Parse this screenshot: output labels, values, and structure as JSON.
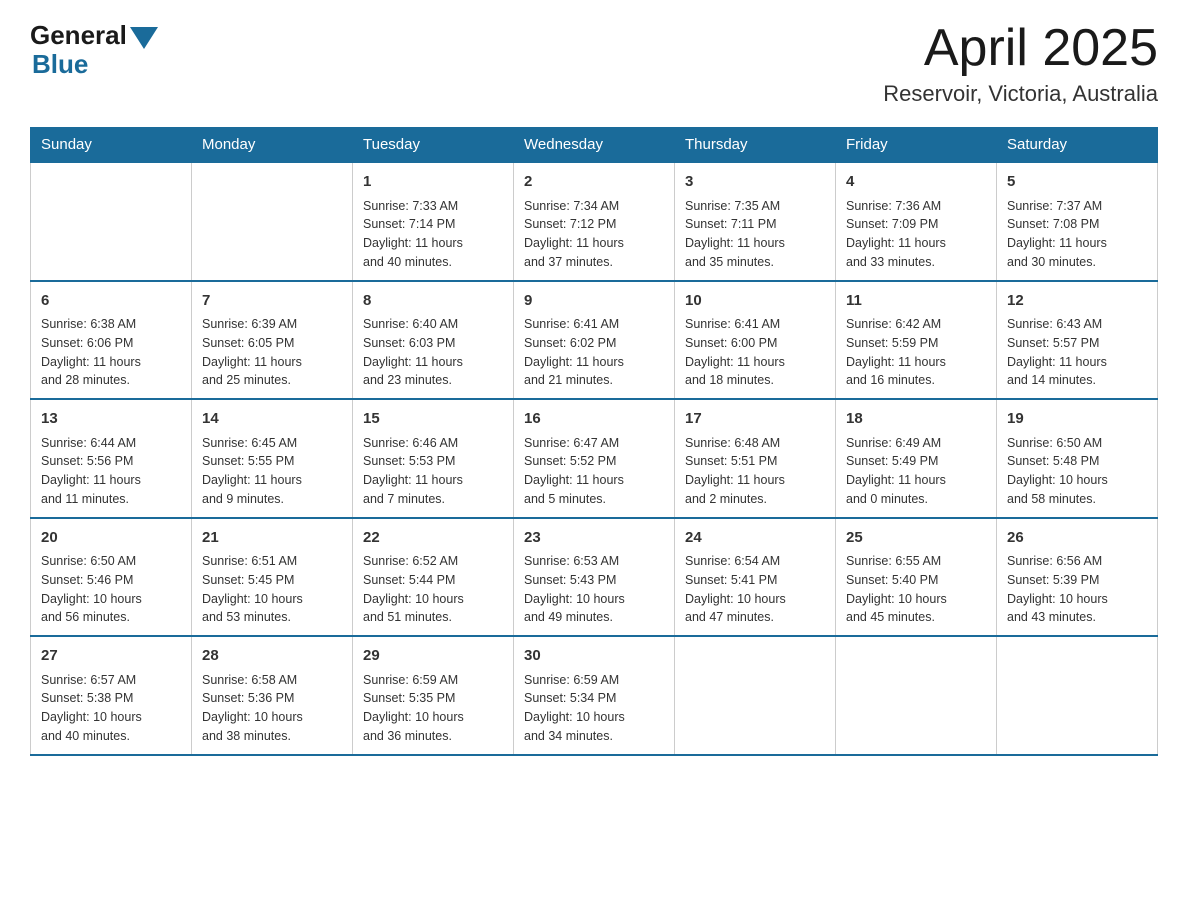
{
  "logo": {
    "general": "General",
    "blue": "Blue"
  },
  "title": "April 2025",
  "subtitle": "Reservoir, Victoria, Australia",
  "days_of_week": [
    "Sunday",
    "Monday",
    "Tuesday",
    "Wednesday",
    "Thursday",
    "Friday",
    "Saturday"
  ],
  "weeks": [
    [
      {
        "day": "",
        "info": ""
      },
      {
        "day": "",
        "info": ""
      },
      {
        "day": "1",
        "info": "Sunrise: 7:33 AM\nSunset: 7:14 PM\nDaylight: 11 hours\nand 40 minutes."
      },
      {
        "day": "2",
        "info": "Sunrise: 7:34 AM\nSunset: 7:12 PM\nDaylight: 11 hours\nand 37 minutes."
      },
      {
        "day": "3",
        "info": "Sunrise: 7:35 AM\nSunset: 7:11 PM\nDaylight: 11 hours\nand 35 minutes."
      },
      {
        "day": "4",
        "info": "Sunrise: 7:36 AM\nSunset: 7:09 PM\nDaylight: 11 hours\nand 33 minutes."
      },
      {
        "day": "5",
        "info": "Sunrise: 7:37 AM\nSunset: 7:08 PM\nDaylight: 11 hours\nand 30 minutes."
      }
    ],
    [
      {
        "day": "6",
        "info": "Sunrise: 6:38 AM\nSunset: 6:06 PM\nDaylight: 11 hours\nand 28 minutes."
      },
      {
        "day": "7",
        "info": "Sunrise: 6:39 AM\nSunset: 6:05 PM\nDaylight: 11 hours\nand 25 minutes."
      },
      {
        "day": "8",
        "info": "Sunrise: 6:40 AM\nSunset: 6:03 PM\nDaylight: 11 hours\nand 23 minutes."
      },
      {
        "day": "9",
        "info": "Sunrise: 6:41 AM\nSunset: 6:02 PM\nDaylight: 11 hours\nand 21 minutes."
      },
      {
        "day": "10",
        "info": "Sunrise: 6:41 AM\nSunset: 6:00 PM\nDaylight: 11 hours\nand 18 minutes."
      },
      {
        "day": "11",
        "info": "Sunrise: 6:42 AM\nSunset: 5:59 PM\nDaylight: 11 hours\nand 16 minutes."
      },
      {
        "day": "12",
        "info": "Sunrise: 6:43 AM\nSunset: 5:57 PM\nDaylight: 11 hours\nand 14 minutes."
      }
    ],
    [
      {
        "day": "13",
        "info": "Sunrise: 6:44 AM\nSunset: 5:56 PM\nDaylight: 11 hours\nand 11 minutes."
      },
      {
        "day": "14",
        "info": "Sunrise: 6:45 AM\nSunset: 5:55 PM\nDaylight: 11 hours\nand 9 minutes."
      },
      {
        "day": "15",
        "info": "Sunrise: 6:46 AM\nSunset: 5:53 PM\nDaylight: 11 hours\nand 7 minutes."
      },
      {
        "day": "16",
        "info": "Sunrise: 6:47 AM\nSunset: 5:52 PM\nDaylight: 11 hours\nand 5 minutes."
      },
      {
        "day": "17",
        "info": "Sunrise: 6:48 AM\nSunset: 5:51 PM\nDaylight: 11 hours\nand 2 minutes."
      },
      {
        "day": "18",
        "info": "Sunrise: 6:49 AM\nSunset: 5:49 PM\nDaylight: 11 hours\nand 0 minutes."
      },
      {
        "day": "19",
        "info": "Sunrise: 6:50 AM\nSunset: 5:48 PM\nDaylight: 10 hours\nand 58 minutes."
      }
    ],
    [
      {
        "day": "20",
        "info": "Sunrise: 6:50 AM\nSunset: 5:46 PM\nDaylight: 10 hours\nand 56 minutes."
      },
      {
        "day": "21",
        "info": "Sunrise: 6:51 AM\nSunset: 5:45 PM\nDaylight: 10 hours\nand 53 minutes."
      },
      {
        "day": "22",
        "info": "Sunrise: 6:52 AM\nSunset: 5:44 PM\nDaylight: 10 hours\nand 51 minutes."
      },
      {
        "day": "23",
        "info": "Sunrise: 6:53 AM\nSunset: 5:43 PM\nDaylight: 10 hours\nand 49 minutes."
      },
      {
        "day": "24",
        "info": "Sunrise: 6:54 AM\nSunset: 5:41 PM\nDaylight: 10 hours\nand 47 minutes."
      },
      {
        "day": "25",
        "info": "Sunrise: 6:55 AM\nSunset: 5:40 PM\nDaylight: 10 hours\nand 45 minutes."
      },
      {
        "day": "26",
        "info": "Sunrise: 6:56 AM\nSunset: 5:39 PM\nDaylight: 10 hours\nand 43 minutes."
      }
    ],
    [
      {
        "day": "27",
        "info": "Sunrise: 6:57 AM\nSunset: 5:38 PM\nDaylight: 10 hours\nand 40 minutes."
      },
      {
        "day": "28",
        "info": "Sunrise: 6:58 AM\nSunset: 5:36 PM\nDaylight: 10 hours\nand 38 minutes."
      },
      {
        "day": "29",
        "info": "Sunrise: 6:59 AM\nSunset: 5:35 PM\nDaylight: 10 hours\nand 36 minutes."
      },
      {
        "day": "30",
        "info": "Sunrise: 6:59 AM\nSunset: 5:34 PM\nDaylight: 10 hours\nand 34 minutes."
      },
      {
        "day": "",
        "info": ""
      },
      {
        "day": "",
        "info": ""
      },
      {
        "day": "",
        "info": ""
      }
    ]
  ]
}
